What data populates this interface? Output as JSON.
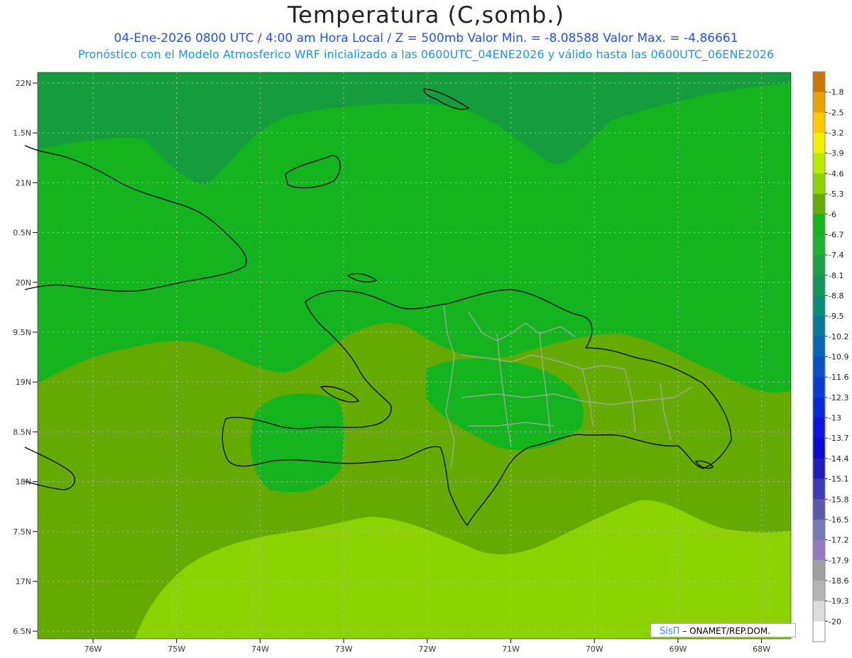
{
  "header": {
    "title": "Temperatura (C,somb.)",
    "line1": "04-Ene-2026  0800 UTC / 4:00 am Hora Local / Z = 500mb  Valor Min. = -8.08588  Valor Max. = -4.86661",
    "line2": "Pronóstico con el Modelo Atmosferico WRF inicializado a las 0600UTC_04ENE2026 y válido hasta las  0600UTC_06ENE2026"
  },
  "map": {
    "lat_labels": [
      "22N",
      "1.5N",
      "21N",
      "0.5N",
      "20N",
      "9.5N",
      "19N",
      "8.5N",
      "18N",
      "7.5N",
      "17N",
      "6.5N"
    ],
    "lon_labels": [
      "76W",
      "75W",
      "74W",
      "73W",
      "72W",
      "71W",
      "70W",
      "69W",
      "68W"
    ],
    "colors": {
      "band_dark": "#159c3c",
      "band_main": "#14b41e",
      "band_olive": "#64aa00",
      "band_lime": "#8cd200",
      "coast": "#000000",
      "borders": "#a8a8a8",
      "grid": "#bbbbbb"
    }
  },
  "colorbar": {
    "labels": [
      "-1.8",
      "-2.5",
      "-3.2",
      "-3.9",
      "-4.6",
      "-5.3",
      "-6",
      "-6.7",
      "-7.4",
      "-8.1",
      "-8.8",
      "-9.5",
      "-10.2",
      "-10.9",
      "-11.6",
      "-12.3",
      "-13",
      "-13.7",
      "-14.4",
      "-15.1",
      "-15.8",
      "-16.5",
      "-17.2",
      "-17.9",
      "-18.6",
      "-19.3",
      "-20"
    ],
    "colors": [
      "#c87800",
      "#e6a000",
      "#ffc800",
      "#f0f000",
      "#b4eb00",
      "#8cd200",
      "#64aa00",
      "#14b41e",
      "#1eb432",
      "#1ea046",
      "#14965a",
      "#0a8c78",
      "#0a7896",
      "#0a64b4",
      "#0a50c8",
      "#0a3cd2",
      "#0a28dc",
      "#0a14e6",
      "#0a0ad2",
      "#1e1ebe",
      "#3c3cb4",
      "#5a5aaa",
      "#7878b4",
      "#9678be",
      "#a0a0a0",
      "#b4b4b4",
      "#dcdcdc",
      "#ffffff"
    ]
  },
  "credit": {
    "logo": "SisΠ",
    "text": "– ONAMET/REP.DOM."
  }
}
